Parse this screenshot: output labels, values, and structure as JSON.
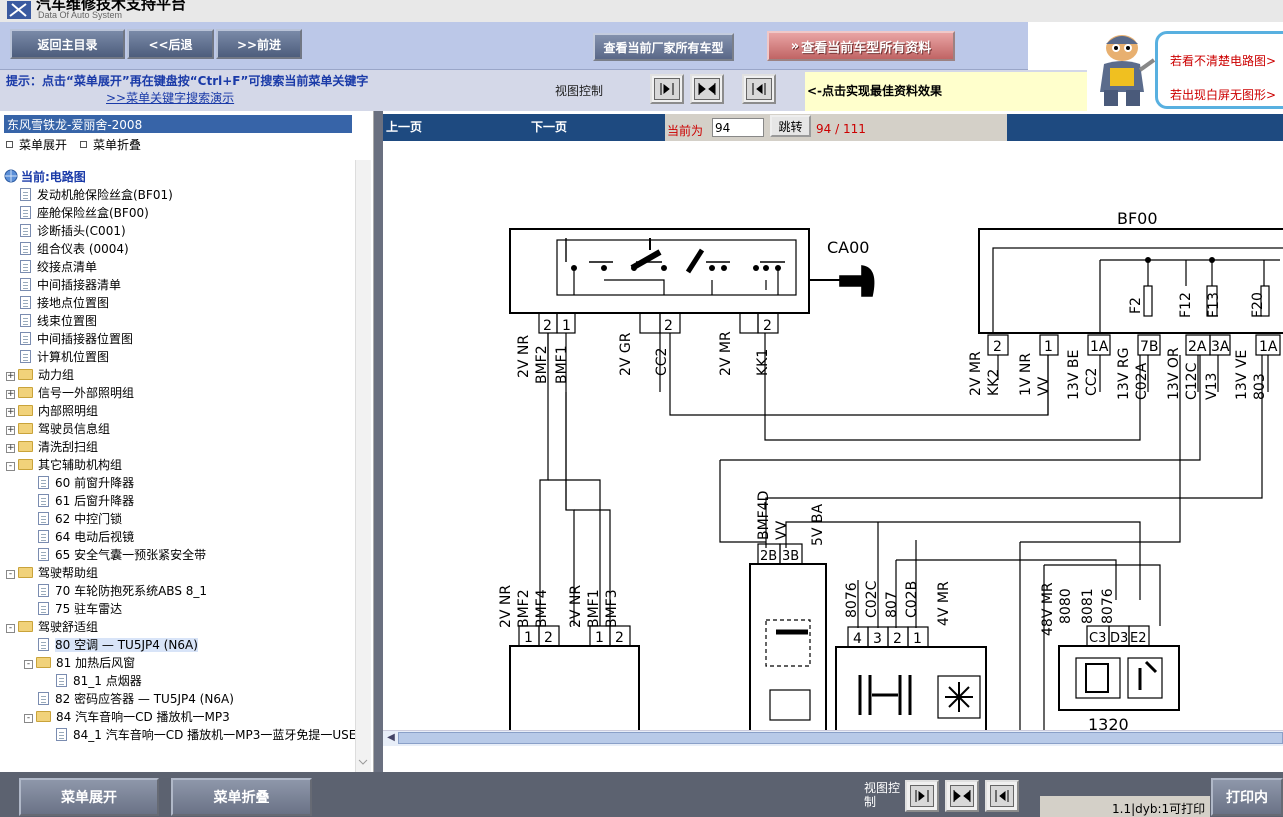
{
  "app": {
    "title": "汽车维修技术支持平台",
    "subtitle": "Data Of Auto System"
  },
  "toolbar": {
    "home": "返回主目录",
    "back": "<<后退",
    "forward": ">>前进",
    "all_makers": "查看当前厂家所有车型",
    "all_model_data": "查看当前车型所有资料"
  },
  "hint": {
    "text": "提示：点击“菜单展开”再在键盘按“Ctrl+F”可搜索当前菜单关键字",
    "link": ">>菜单关键字搜索演示",
    "view_control": "视图控制",
    "best_effect": "<-点击实现最佳资料效果"
  },
  "support": {
    "line1": "若看不清楚电路图>",
    "line2": "若出现白屏无图形>"
  },
  "sidebar": {
    "vehicle": "东风雪铁龙-爱丽舍-2008",
    "expand": "菜单展开",
    "collapse": "菜单折叠",
    "current": "当前:电路图",
    "items": [
      "发动机舱保险丝盒(BF01)",
      "座舱保险丝盒(BF00)",
      "诊断插头(C001)",
      "组合仪表 (0004)",
      "绞接点清单",
      "中间插接器清单",
      "接地点位置图",
      "线束位置图",
      "中间插接器位置图",
      "计算机位置图",
      "动力组",
      "信号一外部照明组",
      "内部照明组",
      "驾驶员信息组",
      "清洗刮扫组",
      "其它辅助机构组",
      "60 前窗升降器",
      "61 后窗升降器",
      "62 中控门锁",
      "64 电动后视镜",
      "65 安全气囊一预张紧安全带",
      "驾驶帮助组",
      "70 车轮防抱死系统ABS 8_1",
      "75 驻车雷达",
      "驾驶舒适组",
      "80 空调 — TU5JP4 (N6A)",
      "81 加热后风窗",
      "81_1 点烟器",
      "82 密码应答器 — TU5JP4 (N6A)",
      "84 汽车音响一CD 播放机一MP3",
      "84_1 汽车音响一CD 播放机一MP3一蓝牙免提一USE"
    ]
  },
  "pager": {
    "prev": "上一页",
    "next": "下一页",
    "current_label": "当前为",
    "current_value": "94",
    "go": "跳转",
    "total": "94 / 111"
  },
  "diagram": {
    "labels": {
      "ca00": "CA00",
      "bf00": "BF00",
      "c1320": "1320",
      "w2v_nr": "2V NR",
      "w_bmf2": "BMF2",
      "w_bmf1": "BMF1",
      "w2v_gr": "2V GR",
      "w_cc2": "CC2",
      "w2v_mr": "2V MR",
      "w_kk1": "KK1",
      "w_kk2": "KK2",
      "w1v_nr": "1V NR",
      "w_vv": "VV",
      "w13v_be": "13V BE",
      "w13v_rg": "13V RG",
      "w_c02a": "C02A",
      "w13v_or": "13V OR",
      "w_c12c": "C12C",
      "w_v13": "V13",
      "w13v_ve": "13V VE",
      "w_803": "803",
      "f2": "F2",
      "f12": "F12",
      "f13": "F13",
      "f20": "F20",
      "w_bmf4d": "BMF4D",
      "w5v_ba": "5V BA",
      "w_bmf4": "BMF4",
      "w_bmf3": "BMF3",
      "w_8076": "8076",
      "w_c02c": "C02C",
      "w_807": "807",
      "w_c02b": "C02B",
      "w4v_mr": "4V MR",
      "w48v_mr": "48V MR",
      "w_8080": "8080",
      "w_8081": "8081",
      "pin_2b": "2B",
      "pin_3b": "3B",
      "pin_c3": "C3",
      "pin_d3": "D3",
      "pin_e2": "E2",
      "pin_2a": "2A",
      "pin_3a": "3A",
      "pin_1a": "1A",
      "pin_7b": "7B",
      "pin_1": "1",
      "pin_2": "2",
      "pin_3": "3",
      "pin_4": "4"
    }
  },
  "bottom": {
    "expand": "菜单展开",
    "collapse": "菜单折叠",
    "view_control": "视图控制",
    "status": "1.1|dyb:1可打印",
    "print": "打印内"
  }
}
